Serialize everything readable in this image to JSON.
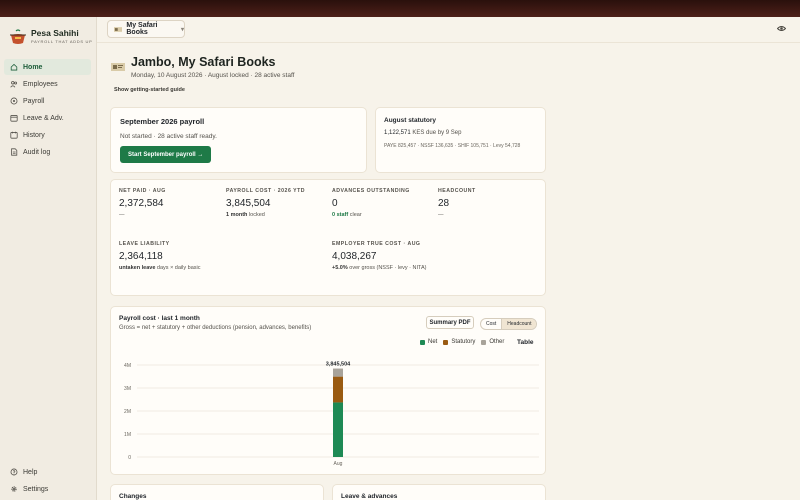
{
  "brand": {
    "name": "Pesa Sahihi",
    "tagline": "PAYROLL THAT ADDS UP"
  },
  "nav": {
    "items": [
      {
        "label": "Home",
        "icon": "home-icon",
        "active": true
      },
      {
        "label": "Employees",
        "icon": "users-icon"
      },
      {
        "label": "Payroll",
        "icon": "payroll-icon"
      },
      {
        "label": "Leave & Adv.",
        "icon": "calendar-icon"
      },
      {
        "label": "History",
        "icon": "history-icon"
      },
      {
        "label": "Audit log",
        "icon": "document-icon"
      }
    ],
    "bottom": [
      {
        "label": "Help",
        "icon": "help-icon"
      },
      {
        "label": "Settings",
        "icon": "gear-icon"
      }
    ]
  },
  "header": {
    "company": "My Safari Books"
  },
  "welcome": {
    "title": "Jambo, My Safari Books",
    "subtitle": "Monday, 10 August 2026 · August locked · 28 active staff",
    "guide_link": "Show getting-started guide"
  },
  "payroll_card": {
    "title": "September 2026 payroll",
    "status": "Not started · 28 active staff ready.",
    "button": "Start September payroll →"
  },
  "statutory": {
    "title": "August statutory",
    "amount": "1,122,571",
    "due": "KES due by 9 Sep",
    "breakdown": "PAYE 825,457 · NSSF 136,635 · SHIF 105,751 · Levy 54,728"
  },
  "kpis": {
    "net_paid": {
      "label": "NET PAID · AUG",
      "value": "2,372,584",
      "sub": "—"
    },
    "payroll_cost": {
      "label": "PAYROLL COST · 2026 YTD",
      "value": "3,845,504",
      "sub_bold": "1 month",
      "sub": " locked"
    },
    "advances": {
      "label": "ADVANCES OUTSTANDING",
      "value": "0",
      "sub_bold": "0 staff",
      "sub": " clear"
    },
    "headcount": {
      "label": "HEADCOUNT",
      "value": "28",
      "sub": "—"
    },
    "leave": {
      "label": "LEAVE LIABILITY",
      "value": "2,364,118",
      "sub_bold": "untaken leave",
      "sub": " days × daily basic"
    },
    "employer": {
      "label": "EMPLOYER TRUE COST · AUG",
      "value": "4,038,267",
      "sub_bold": "+5.0%",
      "sub": " over gross (NSSF · levy · NITA)"
    }
  },
  "chart_card": {
    "title": "Payroll cost · last 1 month",
    "subtitle": "Gross = net + statutory + other deductions (pension, advances, benefits)",
    "summary_button": "Summary PDF",
    "toggle": [
      "Cost",
      "Headcount"
    ],
    "table_link": "Table"
  },
  "chart_data": {
    "type": "bar",
    "stacked": true,
    "categories": [
      "Aug"
    ],
    "series": [
      {
        "name": "Net",
        "values": [
          2372584
        ],
        "color": "#1e8a55"
      },
      {
        "name": "Statutory",
        "values": [
          1122571
        ],
        "color": "#9a5b12"
      },
      {
        "name": "Other",
        "values": [
          350349
        ],
        "color": "#a8a39a"
      }
    ],
    "total_labels": [
      "3,845,504"
    ],
    "yticks": [
      "0",
      "1M",
      "2M",
      "3M",
      "4M"
    ],
    "ylim": [
      0,
      4000000
    ],
    "grid": true,
    "legend": "top-right"
  },
  "bottom_cards": {
    "changes": "Changes",
    "leave": "Leave & advances"
  },
  "colors": {
    "accent": "#1e7a47",
    "topbar": "#2a100c",
    "background": "#f7f3ea"
  }
}
